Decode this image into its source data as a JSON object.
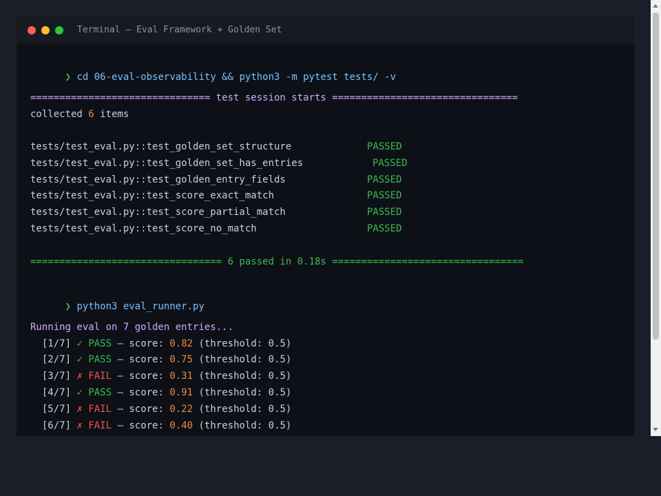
{
  "window": {
    "title": "Terminal — Eval Framework + Golden Set",
    "colors": {
      "close": "#ff5f57",
      "minimize": "#febc2e",
      "maximize": "#28c840"
    }
  },
  "prompt_symbol": "❯",
  "commands": [
    "cd 06-eval-observability && python3 -m pytest tests/ -v",
    "python3 eval_runner.py"
  ],
  "session_header": "=============================== test session starts ================================",
  "collected": {
    "prefix": "collected ",
    "count": "6",
    "suffix": " items"
  },
  "tests": [
    {
      "name": "tests/test_eval.py::test_golden_set_structure",
      "status": "PASSED"
    },
    {
      "name": "tests/test_eval.py::test_golden_set_has_entries",
      "status": "PASSED"
    },
    {
      "name": "tests/test_eval.py::test_golden_entry_fields",
      "status": "PASSED"
    },
    {
      "name": "tests/test_eval.py::test_score_exact_match",
      "status": "PASSED"
    },
    {
      "name": "tests/test_eval.py::test_score_partial_match",
      "status": "PASSED"
    },
    {
      "name": "tests/test_eval.py::test_score_no_match",
      "status": "PASSED"
    }
  ],
  "summary": "================================= 6 passed in 0.18s =================================",
  "eval_header": "Running eval on 7 golden entries...",
  "eval_results": [
    {
      "index": "[1/7]",
      "mark": "✓",
      "result": "PASS",
      "sep": " — score: ",
      "score": "0.82",
      "threshold": " (threshold: 0.5)"
    },
    {
      "index": "[2/7]",
      "mark": "✓",
      "result": "PASS",
      "sep": " — score: ",
      "score": "0.75",
      "threshold": " (threshold: 0.5)"
    },
    {
      "index": "[3/7]",
      "mark": "✗",
      "result": "FAIL",
      "sep": " — score: ",
      "score": "0.31",
      "threshold": " (threshold: 0.5)"
    },
    {
      "index": "[4/7]",
      "mark": "✓",
      "result": "PASS",
      "sep": " — score: ",
      "score": "0.91",
      "threshold": " (threshold: 0.5)"
    },
    {
      "index": "[5/7]",
      "mark": "✗",
      "result": "FAIL",
      "sep": " — score: ",
      "score": "0.22",
      "threshold": " (threshold: 0.5)"
    },
    {
      "index": "[6/7]",
      "mark": "✗",
      "result": "FAIL",
      "sep": " — score: ",
      "score": "0.40",
      "threshold": " (threshold: 0.5)"
    }
  ],
  "colors": {
    "prompt": "#3fb950",
    "command": "#79c0ff",
    "header": "#d2a8ff",
    "pass": "#3fb950",
    "fail": "#f85149",
    "number": "#f0883e",
    "text": "#c9d1d9"
  }
}
